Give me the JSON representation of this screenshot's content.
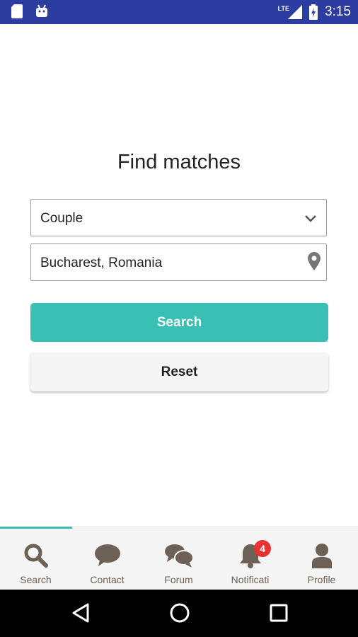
{
  "status_bar": {
    "time": "3:15",
    "network": "LTE",
    "icons": [
      "sd-card-icon",
      "android-icon",
      "signal-icon",
      "battery-charging-icon"
    ]
  },
  "page": {
    "title": "Find matches"
  },
  "form": {
    "type_select_value": "Couple",
    "location_value": "Bucharest, Romania",
    "search_label": "Search",
    "reset_label": "Reset"
  },
  "tabs": [
    {
      "label": "Search",
      "icon": "search-icon",
      "active": true
    },
    {
      "label": "Contact",
      "icon": "chat-bubble-icon"
    },
    {
      "label": "Forum",
      "icon": "forum-icon"
    },
    {
      "label": "Notificati",
      "icon": "bell-icon",
      "badge": "4"
    },
    {
      "label": "Profile",
      "icon": "person-icon"
    }
  ],
  "colors": {
    "status_bar": "#2d3ca0",
    "accent": "#3abfb5",
    "tab_icon": "#6d6055",
    "badge": "#e83232"
  }
}
